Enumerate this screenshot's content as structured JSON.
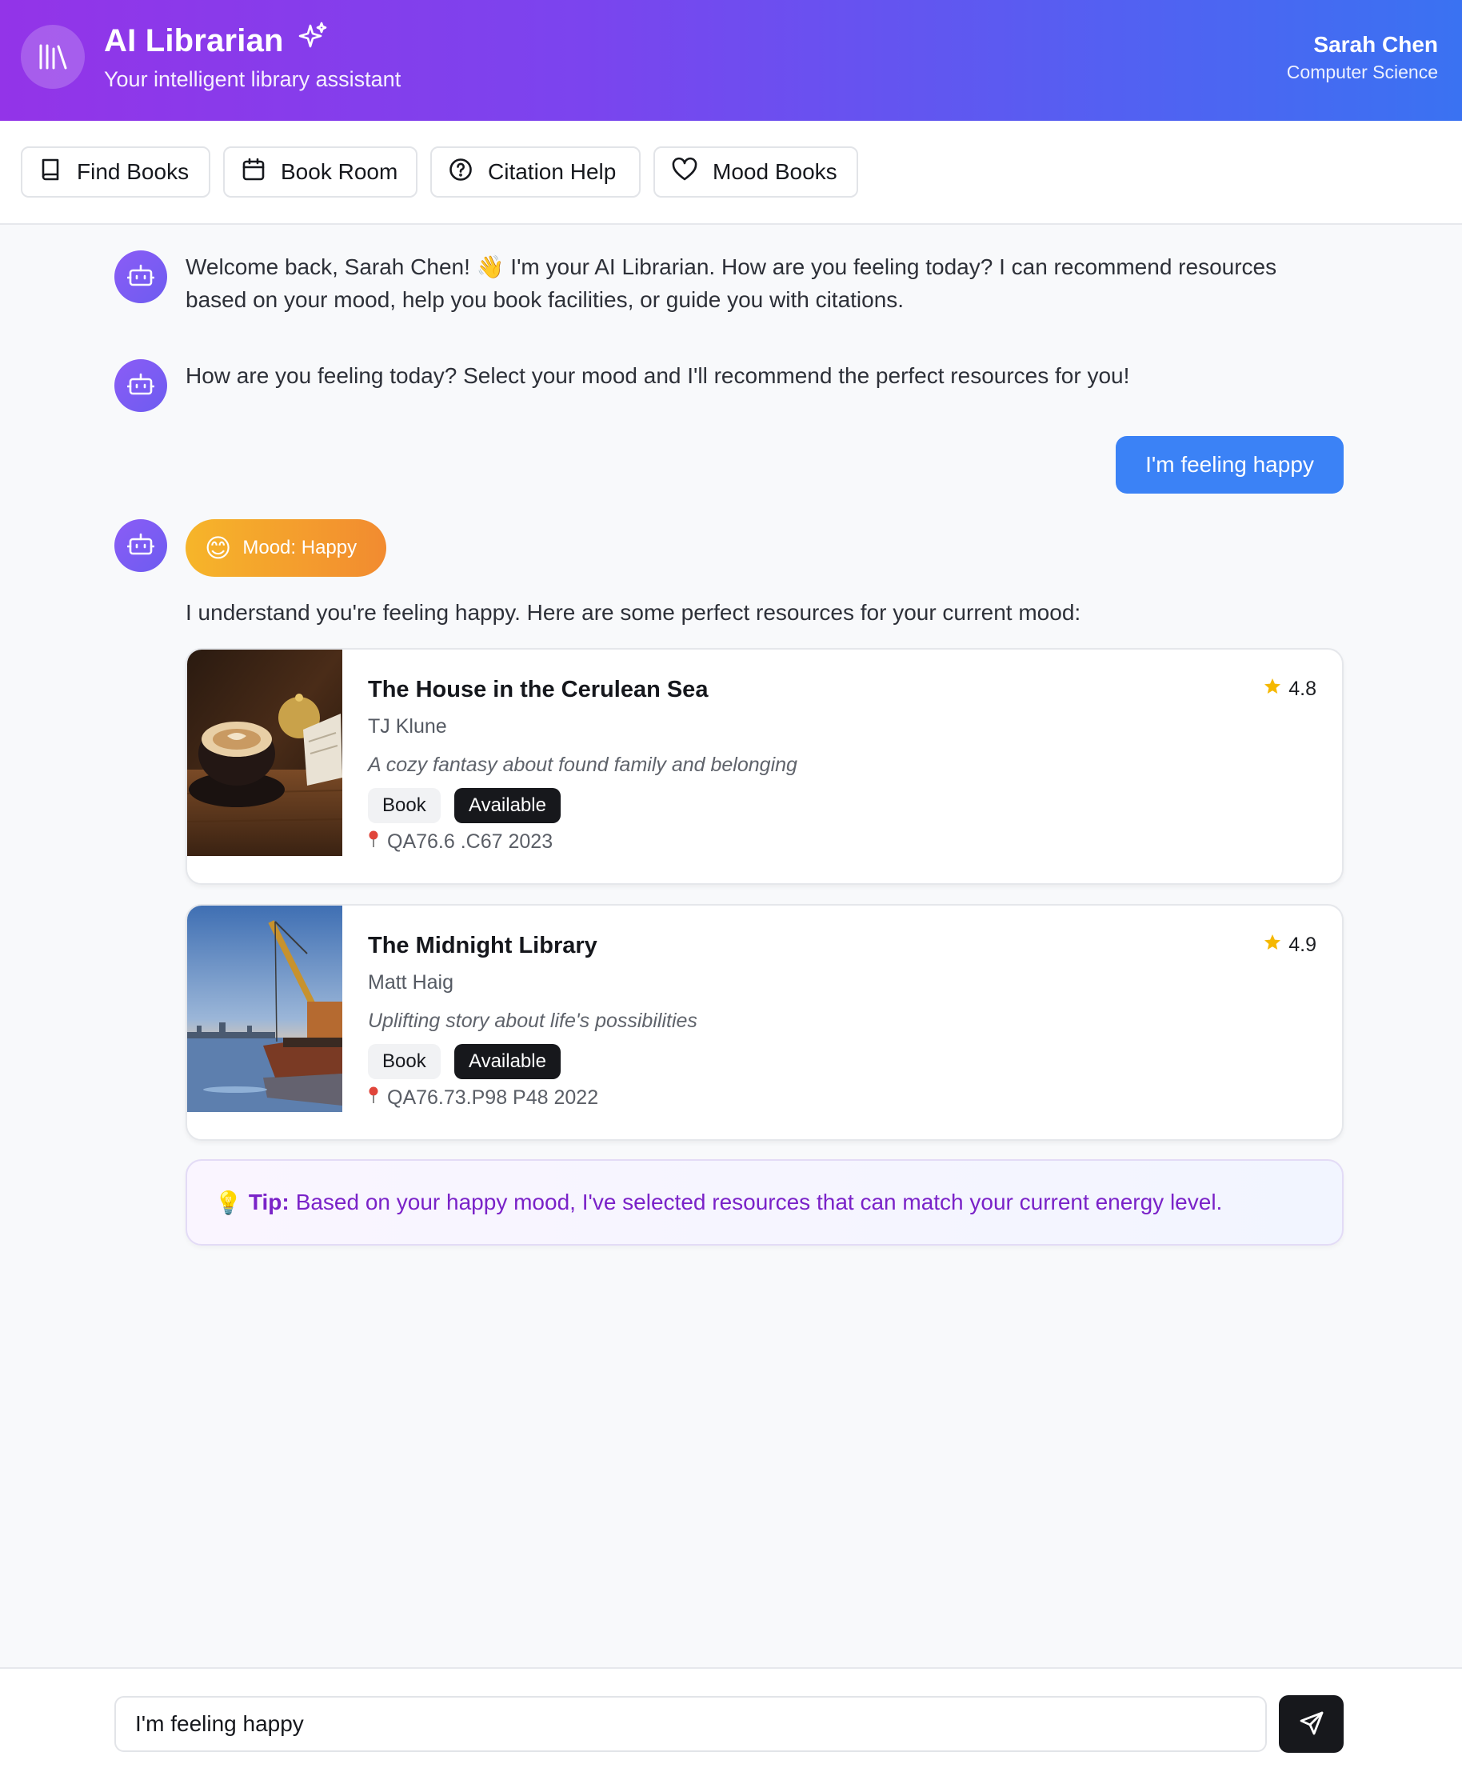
{
  "header": {
    "title": "AI Librarian",
    "subtitle": "Your intelligent library assistant",
    "user_name": "Sarah Chen",
    "user_department": "Computer Science"
  },
  "toolbar": {
    "find_books": "Find Books",
    "book_room": "Book Room",
    "citation_help": "Citation Help",
    "mood_books": "Mood Books"
  },
  "messages": {
    "welcome_line1": "Welcome back, Sarah Chen! 👋 I'm your AI Librarian. How are you feeling today? I can recommend resources",
    "welcome_line2": "based on your mood, help you book facilities, or guide you with citations.",
    "mood_prompt": "How are you feeling today? Select your mood and I'll recommend the perfect resources for you!",
    "user_message": "I'm feeling happy",
    "mood_emoji": "😊",
    "mood_badge": "Mood: Happy",
    "recommend_intro": "I understand you're feeling happy. Here are some perfect resources for your current mood:"
  },
  "recommendations": [
    {
      "title": "The House in the Cerulean Sea",
      "author": "TJ Klune",
      "description": "A cozy fantasy about found family and belonging",
      "type": "Book",
      "status": "Available",
      "call_number": "QA76.6 .C67 2023",
      "rating": "4.8",
      "thumbnail": "coffee-table-photo"
    },
    {
      "title": "The Midnight Library",
      "author": "Matt Haig",
      "description": "Uplifting story about life's possibilities",
      "type": "Book",
      "status": "Available",
      "call_number": "QA76.73.P98 P48 2022",
      "rating": "4.9",
      "thumbnail": "harbor-crane-photo"
    }
  ],
  "tip": {
    "icon": "💡",
    "label": "Tip:",
    "text": "Based on your happy mood, I've selected resources that can match your current energy level."
  },
  "composer": {
    "value": "I'm feeling happy"
  },
  "colors": {
    "header_gradient_start": "#9334e8",
    "header_gradient_end": "#3a72f2",
    "user_bubble": "#3b82f6",
    "mood_badge_start": "#f6b52a",
    "mood_badge_end": "#f28b30",
    "tip_text": "#7a22c8",
    "star": "#f5b800"
  }
}
